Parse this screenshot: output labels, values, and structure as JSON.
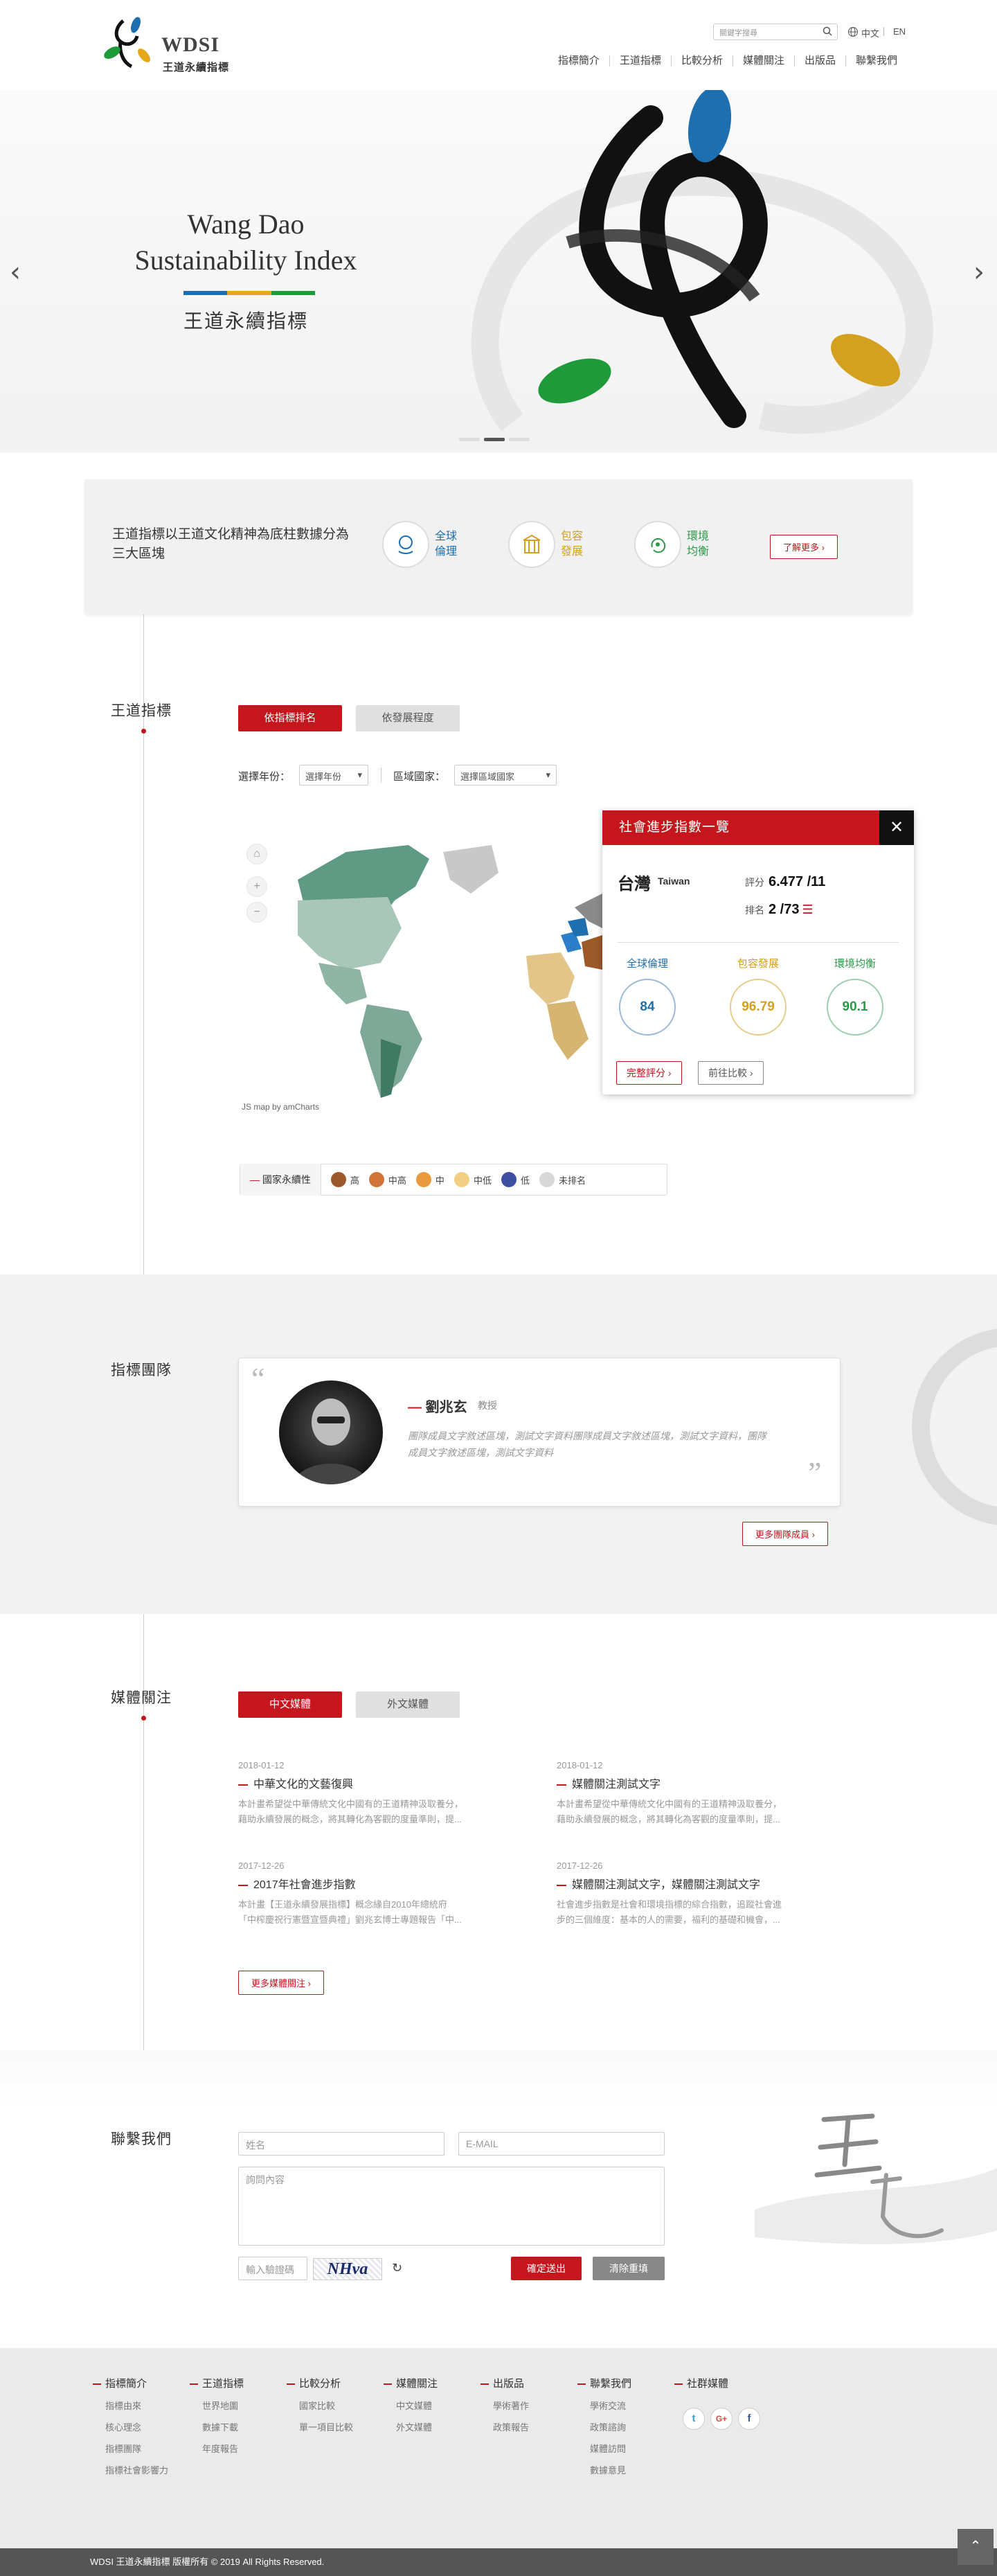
{
  "header": {
    "logo_title": "WDSI",
    "logo_sub": "王道永續指標",
    "search_placeholder": "關鍵字搜尋",
    "lang_zh": "中文",
    "lang_en": "EN",
    "nav": [
      "指標簡介",
      "王道指標",
      "比較分析",
      "媒體關注",
      "出版品",
      "聯繫我們"
    ]
  },
  "hero": {
    "title_line1": "Wang Dao",
    "title_line2": "Sustainability Index",
    "subtitle": "王道永續指標",
    "bar_colors": [
      "#1e6fb0",
      "#e6a81c",
      "#1f9a3b"
    ],
    "prev": "‹",
    "next": "›"
  },
  "intro": {
    "text": "王道指標以王道文化精神為底柱數據分為三大區塊",
    "categories": [
      {
        "label": "全球倫理",
        "color": "#1e6fb0"
      },
      {
        "label": "包容發展",
        "color": "#d4a020"
      },
      {
        "label": "環境均衡",
        "color": "#2a9a48"
      }
    ],
    "more": "了解更多 ›"
  },
  "indicators": {
    "section": "王道指標",
    "tabs": [
      "依指標排名",
      "依發展程度"
    ],
    "year_label": "選擇年份：",
    "year_select": "選擇年份",
    "region_label": "區域國家：",
    "region_select": "選擇區域國家",
    "map_credit": "JS map by amCharts",
    "popup": {
      "title": "社會進步指數一覽",
      "close": "✕",
      "country": "台灣",
      "country_en": "Taiwan",
      "score_label": "評分",
      "score": "6.477 /11",
      "rank_label": "排名",
      "rank": "2 /73",
      "dims": [
        {
          "name": "全球倫理",
          "value": "84",
          "color": "#1e6fb0"
        },
        {
          "name": "包容發展",
          "value": "96.79",
          "color": "#d4a020"
        },
        {
          "name": "環境均衡",
          "value": "90.1",
          "color": "#2a9a48"
        }
      ],
      "btn1": "完整評分 ›",
      "btn2": "前往比較 ›"
    },
    "legend": {
      "title": "國家永續性",
      "items": [
        {
          "label": "高",
          "color": "#9c5a2a"
        },
        {
          "label": "中高",
          "color": "#d0743a"
        },
        {
          "label": "中",
          "color": "#e89a3c"
        },
        {
          "label": "中低",
          "color": "#f2cf82"
        },
        {
          "label": "低",
          "color": "#3c4fa0"
        },
        {
          "label": "未排名",
          "color": "#d8d8d8"
        }
      ]
    }
  },
  "team": {
    "section": "指標團隊",
    "name": "劉兆玄",
    "title": "教授",
    "bio": "團隊成員文字敘述區塊，測試文字資料團隊成員文字敘述區塊，測試文字資料，團隊成員文字敘述區塊，測試文字資料",
    "more": "更多團隊成員 ›"
  },
  "media": {
    "section": "媒體關注",
    "tabs": [
      "中文媒體",
      "外文媒體"
    ],
    "items": [
      {
        "date": "2018-01-12",
        "title": "中華文化的文藝復興",
        "desc1": "本計畫希望從中華傳統文化中國有的王道精神汲取養分，",
        "desc2": "藉助永續發展的概念，將其轉化為客觀的度量準則，提..."
      },
      {
        "date": "2018-01-12",
        "title": "媒體關注測試文字",
        "desc1": "本計畫希望從中華傳統文化中國有的王道精神汲取養分，",
        "desc2": "藉助永續發展的概念，將其轉化為客觀的度量準則，提..."
      },
      {
        "date": "2017-12-26",
        "title": "2017年社會進步指數",
        "desc1": "本計畫【王道永續發展指標】概念緣自2010年總統府",
        "desc2": "「中榨慶祝行憲暨宣暨典禮」劉兆玄博士專題報告「中..."
      },
      {
        "date": "2017-12-26",
        "title": "媒體關注測試文字，媒體關注測試文字",
        "desc1": "社會進步指數是社會和環境指標的綜合指數，追蹤社會進",
        "desc2": "步的三個維度：基本的人的需要，福利的基礎和機會，..."
      }
    ],
    "more": "更多媒體關注 ›"
  },
  "contact": {
    "section": "聯繫我們",
    "name_ph": "姓名",
    "email_ph": "E-MAIL",
    "msg_ph": "詢問內容",
    "captcha_ph": "輸入驗證碼",
    "captcha": "NHva",
    "refresh": "↻",
    "submit": "確定送出",
    "clear": "清除重填"
  },
  "footer": {
    "cols": [
      {
        "head": "指標簡介",
        "items": [
          "指標由來",
          "核心理念",
          "指標團隊",
          "指標社會影響力"
        ]
      },
      {
        "head": "王道指標",
        "items": [
          "世界地圖",
          "數據下載",
          "年度報告"
        ]
      },
      {
        "head": "比較分析",
        "items": [
          "國家比較",
          "單一項目比較"
        ]
      },
      {
        "head": "媒體關注",
        "items": [
          "中文媒體",
          "外文媒體"
        ]
      },
      {
        "head": "出版品",
        "items": [
          "學術著作",
          "政策報告"
        ]
      },
      {
        "head": "聯繫我們",
        "items": [
          "學術交流",
          "政策諮詢",
          "媒體訪問",
          "數據意見"
        ]
      },
      {
        "head": "社群媒體",
        "items": []
      }
    ],
    "social": [
      "t",
      "G+",
      "f"
    ],
    "copyright": "WDSI 王道永續指標 版權所有 © 2019 All Rights Reserved.",
    "totop": "⌃"
  }
}
